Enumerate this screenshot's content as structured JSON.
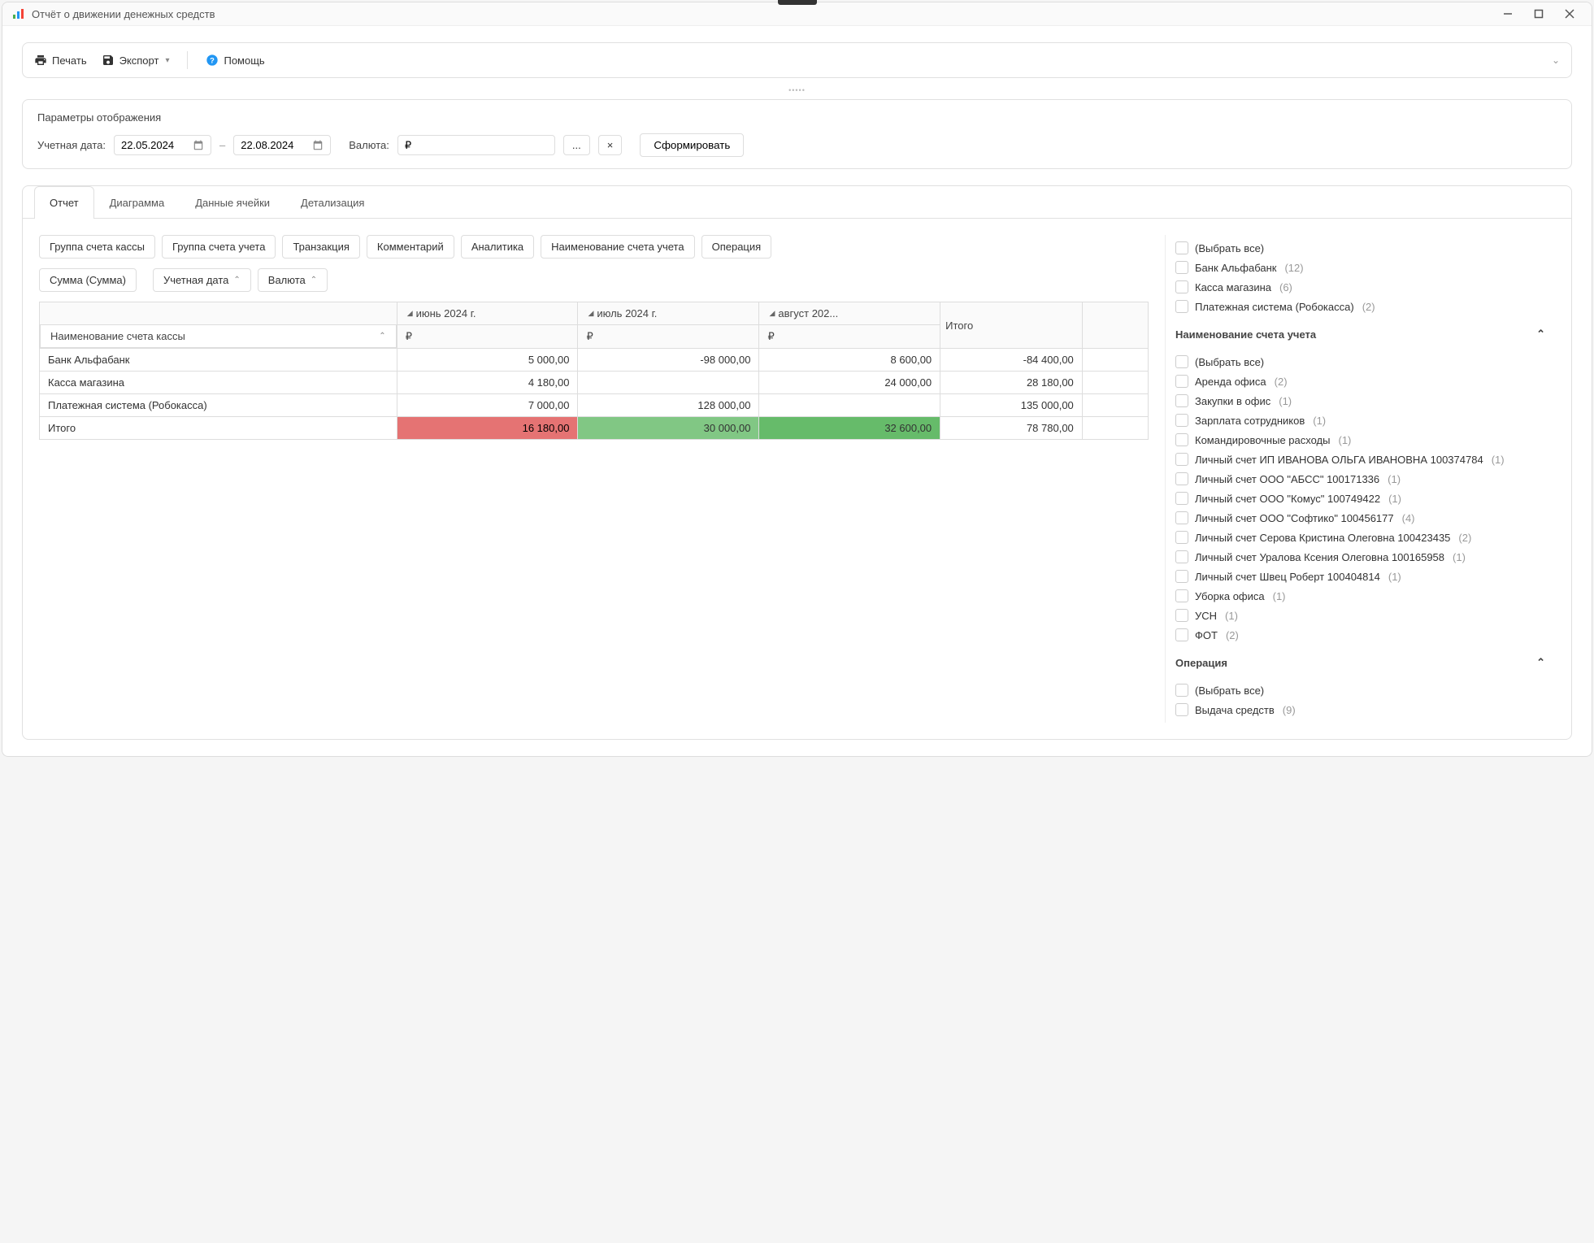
{
  "window": {
    "title": "Отчёт о движении денежных средств"
  },
  "toolbar": {
    "print": "Печать",
    "export": "Экспорт",
    "help": "Помощь"
  },
  "params": {
    "title": "Параметры отображения",
    "date_label": "Учетная дата:",
    "date_from": "22.05.2024",
    "date_to": "22.08.2024",
    "currency_label": "Валюта:",
    "currency_value": "₽",
    "more_btn": "...",
    "clear_btn": "×",
    "generate_btn": "Сформировать"
  },
  "tabs": [
    "Отчет",
    "Диаграмма",
    "Данные ячейки",
    "Детализация"
  ],
  "field_tags": [
    "Группа счета кассы",
    "Группа счета учета",
    "Транзакция",
    "Комментарий",
    "Аналитика",
    "Наименование счета учета",
    "Операция"
  ],
  "pivot": {
    "measure": "Сумма (Сумма)",
    "col_dims": [
      "Учетная дата",
      "Валюта"
    ],
    "row_dim": "Наименование счета кассы",
    "months": [
      "июнь 2024 г.",
      "июль 2024 г.",
      "август 202..."
    ],
    "currency_sub": "₽",
    "total_col": "Итого",
    "rows": [
      {
        "name": "Банк Альфабанк",
        "vals": [
          "5 000,00",
          "-98 000,00",
          "8 600,00"
        ],
        "total": "-84 400,00"
      },
      {
        "name": "Касса магазина",
        "vals": [
          "4 180,00",
          "",
          "24 000,00"
        ],
        "total": "28 180,00"
      },
      {
        "name": "Платежная система (Робокасса)",
        "vals": [
          "7 000,00",
          "128 000,00",
          ""
        ],
        "total": "135 000,00"
      }
    ],
    "total_row": {
      "name": "Итого",
      "vals": [
        "16 180,00",
        "30 000,00",
        "32 600,00"
      ],
      "total": "78 780,00"
    }
  },
  "filters": {
    "top_section_items": [
      {
        "label": "(Выбрать все)",
        "count": ""
      },
      {
        "label": "Банк Альфабанк",
        "count": "(12)"
      },
      {
        "label": "Касса магазина",
        "count": "(6)"
      },
      {
        "label": "Платежная система (Робокасса)",
        "count": "(2)"
      }
    ],
    "section2_title": "Наименование счета учета",
    "section2_items": [
      {
        "label": "(Выбрать все)",
        "count": ""
      },
      {
        "label": "Аренда офиса",
        "count": "(2)"
      },
      {
        "label": "Закупки в офис",
        "count": "(1)"
      },
      {
        "label": "Зарплата сотрудников",
        "count": "(1)"
      },
      {
        "label": "Командировочные расходы",
        "count": "(1)"
      },
      {
        "label": "Личный счет ИП ИВАНОВА ОЛЬГА ИВАНОВНА 100374784",
        "count": "(1)"
      },
      {
        "label": "Личный счет ООО \"АБСС\" 100171336",
        "count": "(1)"
      },
      {
        "label": "Личный счет ООО \"Комус\" 100749422",
        "count": "(1)"
      },
      {
        "label": "Личный счет ООО \"Софтико\" 100456177",
        "count": "(4)"
      },
      {
        "label": "Личный счет Серова Кристина Олеговна 100423435",
        "count": "(2)"
      },
      {
        "label": "Личный счет Уралова Ксения Олеговна 100165958",
        "count": "(1)"
      },
      {
        "label": "Личный счет Швец Роберт 100404814",
        "count": "(1)"
      },
      {
        "label": "Уборка офиса",
        "count": "(1)"
      },
      {
        "label": "УСН",
        "count": "(1)"
      },
      {
        "label": "ФОТ",
        "count": "(2)"
      }
    ],
    "section3_title": "Операция",
    "section3_items": [
      {
        "label": "(Выбрать все)",
        "count": ""
      },
      {
        "label": "Выдача средств",
        "count": "(9)"
      }
    ]
  }
}
